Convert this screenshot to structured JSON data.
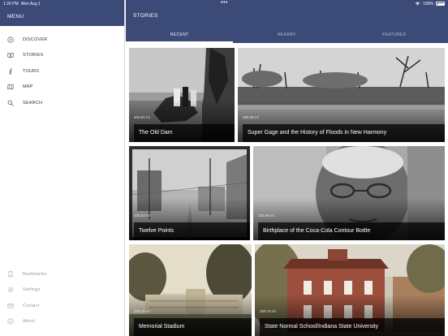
{
  "status_bar": {
    "time": "1:26 PM",
    "date": "Mon Aug 1",
    "battery": "100%"
  },
  "sidebar": {
    "title": "MENU",
    "items": [
      {
        "label": "DISCOVER",
        "icon": "compass-icon"
      },
      {
        "label": "STORIES",
        "icon": "book-icon"
      },
      {
        "label": "TOURS",
        "icon": "walking-icon"
      },
      {
        "label": "MAP",
        "icon": "map-icon"
      },
      {
        "label": "SEARCH",
        "icon": "search-icon"
      }
    ],
    "bottom_items": [
      {
        "label": "Bookmarks",
        "icon": "bookmark-icon"
      },
      {
        "label": "Settings",
        "icon": "gear-icon"
      },
      {
        "label": "Contact",
        "icon": "mail-icon"
      },
      {
        "label": "About",
        "icon": "info-icon"
      }
    ]
  },
  "main": {
    "title": "STORIES",
    "tabs": [
      {
        "label": "RECENT",
        "active": true
      },
      {
        "label": "NEARBY",
        "active": false
      },
      {
        "label": "FEATURED",
        "active": false
      }
    ],
    "cards": [
      {
        "title": "The Old Dam",
        "distance": "403.81 mi"
      },
      {
        "title": "Super Gage and the History of Floods in New Harmony",
        "distance": "405.39 mi"
      },
      {
        "title": "Twelve Points",
        "distance": "330.53 mi"
      },
      {
        "title": "Birthplace of the Coca-Cola Contour Bottle",
        "distance": "332.89 mi"
      },
      {
        "title": "Memorial Stadium",
        "distance": "329.76 mi"
      },
      {
        "title": "State Normal School/Indiana State University",
        "distance": "330.70 mi"
      }
    ]
  },
  "colors": {
    "header": "#3b4a76",
    "sidebar_bg": "#ffffff",
    "active_tab_indicator": "#ffffff"
  }
}
